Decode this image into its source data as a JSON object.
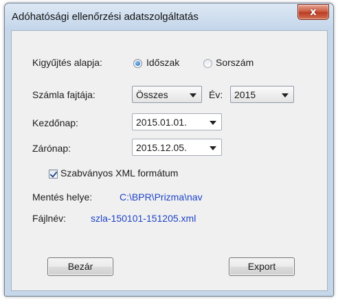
{
  "window": {
    "title": "Adóhatósági ellenőrzési adatszolgáltatás",
    "close_label": "x"
  },
  "collection": {
    "label": "Kigyűjtés alapja:",
    "options": [
      {
        "label": "Időszak",
        "selected": true
      },
      {
        "label": "Sorszám",
        "selected": false
      }
    ]
  },
  "invoice_type": {
    "label": "Számla fajtája:",
    "value": "Összes"
  },
  "year": {
    "label": "Év:",
    "value": "2015"
  },
  "start_date": {
    "label": "Kezdőnap:",
    "value": "2015.01.01."
  },
  "end_date": {
    "label": "Zárónap:",
    "value": "2015.12.05."
  },
  "xml_format": {
    "label": "Szabványos XML formátum",
    "checked": true
  },
  "save_location": {
    "label": "Mentés helye:",
    "value": "C:\\BPR\\Prizma\\nav"
  },
  "filename": {
    "label": "Fájlnév:",
    "value": "szla-150101-151205.xml"
  },
  "buttons": {
    "close": "Bezár",
    "export": "Export"
  },
  "colors": {
    "link_blue": "#1d43c8",
    "titlebar": "#c4d6ea",
    "close_red": "#c9553a"
  }
}
